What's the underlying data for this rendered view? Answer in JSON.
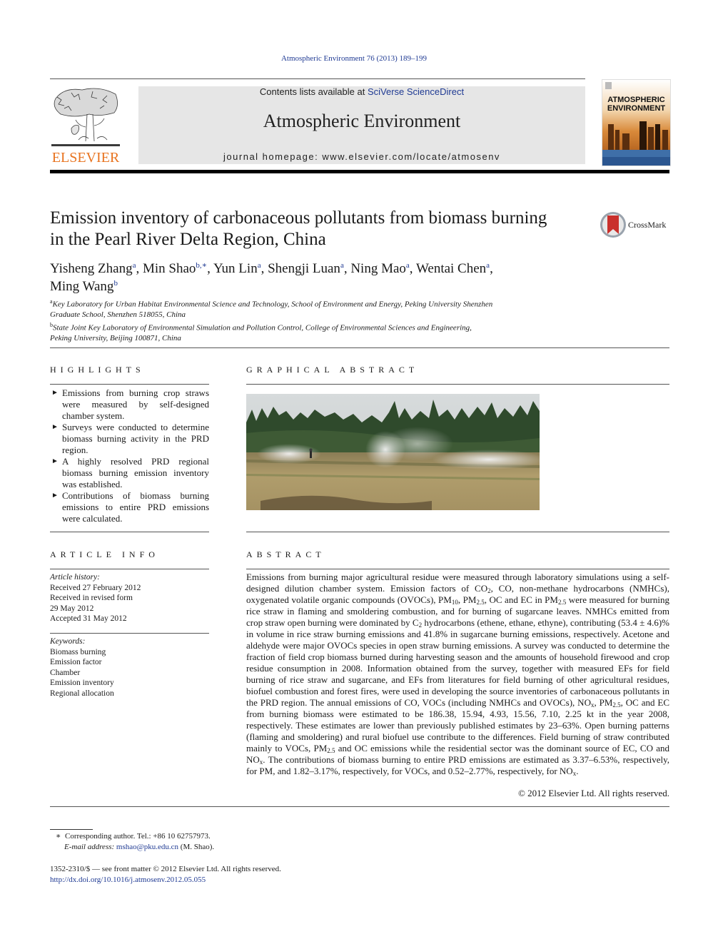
{
  "header": {
    "citation": "Atmospheric Environment 76 (2013) 189–199",
    "publisher_logo_text": "ELSEVIER",
    "contents_prefix": "Contents lists available at ",
    "contents_link": "SciVerse ScienceDirect",
    "journal_name": "Atmospheric Environment",
    "homepage": "journal homepage: www.elsevier.com/locate/atmosenv",
    "cover_title_line1": "ATMOSPHERIC",
    "cover_title_line2": "ENVIRONMENT",
    "colors": {
      "elsevier_orange": "#e8731f",
      "link_blue": "#1f3a93",
      "header_gray": "#e6e6e6"
    }
  },
  "article": {
    "title_line1": "Emission inventory of carbonaceous pollutants from biomass burning",
    "title_line2": "in the Pearl River Delta Region, China",
    "crossmark_label": "CrossMark",
    "authors": [
      {
        "name": "Yisheng Zhang",
        "aff": "a"
      },
      {
        "name": "Min Shao",
        "aff": "b,∗"
      },
      {
        "name": "Yun Lin",
        "aff": "a"
      },
      {
        "name": "Shengji Luan",
        "aff": "a"
      },
      {
        "name": "Ning Mao",
        "aff": "a"
      },
      {
        "name": "Wentai Chen",
        "aff": "a"
      },
      {
        "name": "Ming Wang",
        "aff": "b"
      }
    ],
    "affiliations": [
      {
        "label": "a",
        "line1": "Key Laboratory for Urban Habitat Environmental Science and Technology, School of Environment and Energy, Peking University Shenzhen",
        "line2": "Graduate School, Shenzhen 518055, China"
      },
      {
        "label": "b",
        "line1": "State Joint Key Laboratory of Environmental Simulation and Pollution Control, College of Environmental Sciences and Engineering,",
        "line2": "Peking University, Beijing 100871, China"
      }
    ]
  },
  "highlights": {
    "heading": "HIGHLIGHTS",
    "bullet": "►",
    "items": [
      "Emissions from burning crop straws were measured by self-designed chamber system.",
      "Surveys were conducted to determine biomass burning activity in the PRD region.",
      "A highly resolved PRD regional biomass burning emission inventory was established.",
      "Contributions of biomass burning emissions to entire PRD emissions were calculated."
    ]
  },
  "graphical_abstract": {
    "heading": "GRAPHICAL ABSTRACT",
    "image_alt": "Photo of smoke from open field burning of crop residue in front of a tree line"
  },
  "article_info": {
    "heading": "ARTICLE INFO",
    "history_label": "Article history:",
    "history": [
      "Received 27 February 2012",
      "Received in revised form",
      "29 May 2012",
      "Accepted 31 May 2012"
    ],
    "keywords_label": "Keywords:",
    "keywords": [
      "Biomass burning",
      "Emission factor",
      "Chamber",
      "Emission inventory",
      "Regional allocation"
    ]
  },
  "abstract": {
    "heading": "ABSTRACT",
    "p1": "Emissions from burning major agricultural residue were measured through laboratory simulations using a self-designed dilution chamber system. Emission factors of CO",
    "p2": ", CO, non-methane hydrocarbons (NMHCs), oxygenated volatile organic compounds (OVOCs), PM",
    "p3": ", PM",
    "p4": ", OC and EC in PM",
    "p5": " were measured for burning rice straw in flaming and smoldering combustion, and for burning of sugarcane leaves. NMHCs emitted from crop straw open burning were dominated by C",
    "p6": " hydrocarbons (ethene, ethane, ethyne), contributing (53.4 ± 4.6)% in volume in rice straw burning emissions and 41.8% in sugarcane burning emissions, respectively. Acetone and aldehyde were major OVOCs species in open straw burning emissions. A survey was conducted to determine the fraction of field crop biomass burned during harvesting season and the amounts of household firewood and crop residue consumption in 2008. Information obtained from the survey, together with measured EFs for field burning of rice straw and sugarcane, and EFs from literatures for field burning of other agricultural residues, biofuel combustion and forest fires, were used in developing the source inventories of carbonaceous pollutants in the PRD region. The annual emissions of CO, VOCs (including NMHCs and OVOCs), NO",
    "p7": ", PM",
    "p8": ", OC and EC from burning biomass were estimated to be 186.38, 15.94, 4.93, 15.56, 7.10, 2.25 kt in the year 2008, respectively. These estimates are lower than previously published estimates by 23–63%. Open burning patterns (flaming and smoldering) and rural biofuel use contribute to the differences. Field burning of straw contributed mainly to VOCs, PM",
    "p9": " and OC emissions while the residential sector was the dominant source of EC, CO and NO",
    "p10": ". The contributions of biomass burning to entire PRD emissions are estimated as 3.37–6.53%, respectively, for PM, and 1.82–3.17%, respectively, for VOCs, and 0.52–2.77%, respectively, for NO",
    "p11": ".",
    "sub_2": "2",
    "sub_10": "10",
    "sub_25": "2.5",
    "sub_x": "x",
    "copyright": "© 2012 Elsevier Ltd. All rights reserved."
  },
  "footnotes": {
    "star": "∗",
    "corresponding": "Corresponding author. Tel.: +86 10 62757973.",
    "email_label": "E-mail address:",
    "email": "mshao@pku.edu.cn",
    "email_suffix": " (M. Shao).",
    "issn": "1352-2310/$ — see front matter © 2012 Elsevier Ltd. All rights reserved.",
    "doi": "http://dx.doi.org/10.1016/j.atmosenv.2012.05.055"
  }
}
